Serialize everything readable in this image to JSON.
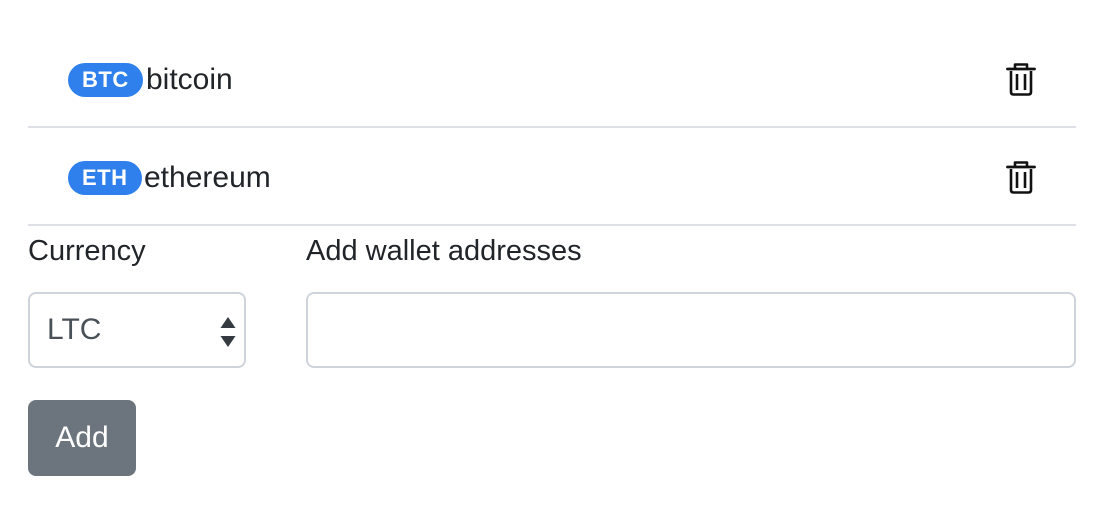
{
  "wallets": [
    {
      "symbol": "BTC",
      "name": "bitcoin",
      "delete_icon": "trash-icon"
    },
    {
      "symbol": "ETH",
      "name": "ethereum",
      "delete_icon": "trash-icon"
    }
  ],
  "form": {
    "currency_label": "Currency",
    "currency_selected": "LTC",
    "address_label": "Add wallet addresses",
    "address_value": "",
    "add_button_label": "Add"
  },
  "colors": {
    "badge": "#2f80ed",
    "add_button": "#6c757d",
    "divider": "#dee2e6",
    "input_border": "#ced4da"
  }
}
